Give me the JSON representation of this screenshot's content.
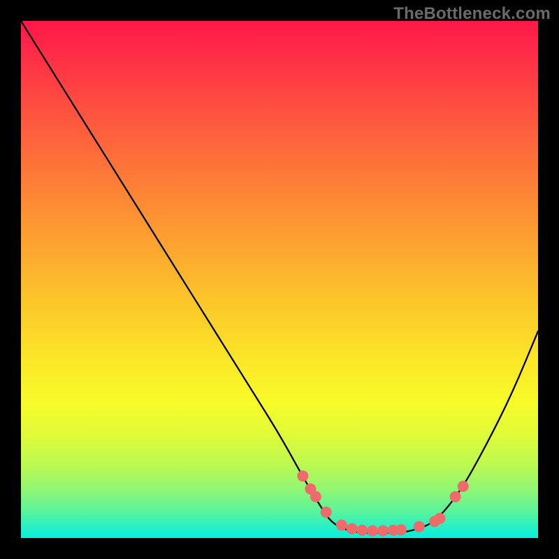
{
  "watermark": "TheBottleneck.com",
  "chart_data": {
    "type": "line",
    "title": "",
    "xlabel": "",
    "ylabel": "",
    "xlim": [
      0,
      100
    ],
    "ylim": [
      0,
      100
    ],
    "series": [
      {
        "name": "bottleneck-curve",
        "x": [
          0,
          5,
          10,
          15,
          20,
          25,
          30,
          35,
          40,
          45,
          50,
          55,
          58,
          60,
          63,
          66,
          70,
          73,
          76,
          80,
          85,
          90,
          95,
          100
        ],
        "y": [
          100,
          92,
          84,
          76,
          68,
          60,
          52,
          44,
          36,
          28,
          20,
          11,
          6,
          3,
          1.5,
          1,
          1,
          1,
          1.5,
          3,
          9,
          18,
          28,
          40
        ]
      }
    ],
    "markers": {
      "name": "highlight-points",
      "color": "#ee6b6b",
      "x": [
        54.5,
        56,
        57,
        59,
        62,
        64,
        66,
        68,
        70,
        72,
        73.5,
        77,
        80,
        81,
        84,
        85.5
      ],
      "y": [
        12,
        9.5,
        8,
        5,
        2.5,
        1.8,
        1.5,
        1.4,
        1.4,
        1.5,
        1.6,
        2.2,
        3.2,
        3.8,
        8,
        10
      ]
    }
  }
}
